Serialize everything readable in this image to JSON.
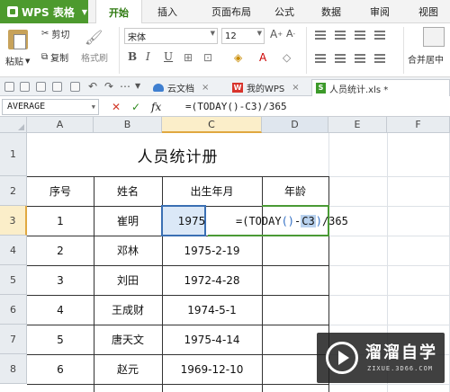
{
  "app": {
    "title": "WPS 表格"
  },
  "menu": {
    "tabs": [
      {
        "label": "开始",
        "active": true
      },
      {
        "label": "插入"
      },
      {
        "label": "页面布局"
      },
      {
        "label": "公式"
      },
      {
        "label": "数据"
      },
      {
        "label": "审阅"
      },
      {
        "label": "视图"
      }
    ]
  },
  "ribbon": {
    "paste": "粘贴",
    "cut": "剪切",
    "copy": "复制",
    "format_painter": "格式刷",
    "font_name": "宋体",
    "font_size": "12",
    "bold": "B",
    "italic": "I",
    "underline": "U",
    "merge_center": "合并居中"
  },
  "doc_tabs": [
    {
      "label": "云文档",
      "icon": "cloud-icon"
    },
    {
      "label": "我的WPS",
      "icon": "wps-w-icon"
    },
    {
      "label": "人员统计.xls *",
      "icon": "spreadsheet-icon",
      "active": true
    }
  ],
  "formula_bar": {
    "name_box": "AVERAGE",
    "cancel_glyph": "✕",
    "confirm_glyph": "✓",
    "fx_glyph": "fx",
    "formula": "=(TODAY()-C3)/365"
  },
  "grid": {
    "columns": [
      "A",
      "B",
      "C",
      "D",
      "E",
      "F"
    ],
    "rows": [
      "1",
      "2",
      "3",
      "4",
      "5",
      "6",
      "7",
      "8"
    ],
    "title": "人员统计册",
    "headers": [
      "序号",
      "姓名",
      "出生年月",
      "年龄"
    ],
    "records": [
      {
        "no": "1",
        "name": "崔明",
        "birth": "1975"
      },
      {
        "no": "2",
        "name": "邓林",
        "birth": "1975-2-19"
      },
      {
        "no": "3",
        "name": "刘田",
        "birth": "1972-4-28"
      },
      {
        "no": "4",
        "name": "王成财",
        "birth": "1974-5-1"
      },
      {
        "no": "5",
        "name": "唐天文",
        "birth": "1975-4-14"
      },
      {
        "no": "6",
        "name": "赵元",
        "birth": "1969-12-10"
      }
    ],
    "editing": {
      "prefix": "=(TODAY",
      "paren": "()",
      "minus": "-",
      "ref": "C3",
      "close": ")",
      "suffix": "/365"
    }
  },
  "watermark": {
    "title": "溜溜自学",
    "url": "ZIXUE.3D66.COM"
  },
  "colors": {
    "brand_green": "#4d9a2e",
    "selection_blue": "#3a6fb3",
    "header_selected": "#fbeec9"
  }
}
